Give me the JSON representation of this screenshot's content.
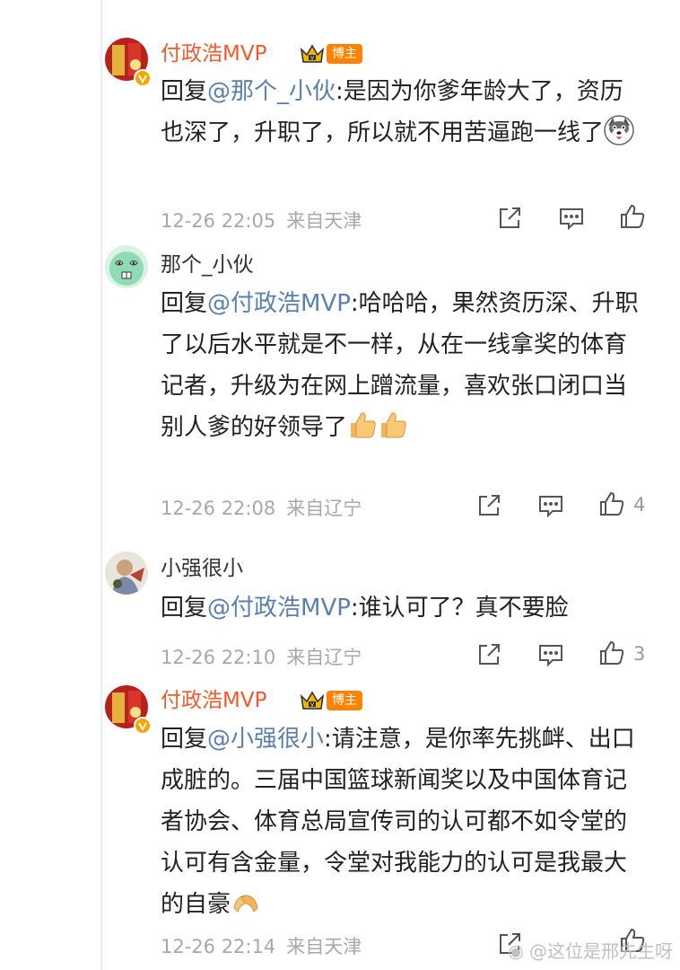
{
  "comments": [
    {
      "name": "付政浩MVP",
      "badge": "博主",
      "reply_prefix": "回复",
      "mention": "@那个_小伙",
      "body": ":是因为你爹年龄大了，资历也深了，升职了，所以就不用苦逼跑一线了",
      "time": "12-26 22:05",
      "source": "来自天津",
      "likes": ""
    },
    {
      "name": "那个_小伙",
      "reply_prefix": "回复",
      "mention": "@付政浩MVP",
      "body": ":哈哈哈，果然资历深、升职了以后水平就是不一样，从在一线拿奖的体育记者，升级为在网上蹭流量，喜欢张口闭口当别人爹的好领导了",
      "time": "12-26 22:08",
      "source": "来自辽宁",
      "likes": "4"
    },
    {
      "name": "小强很小",
      "reply_prefix": "回复",
      "mention": "@付政浩MVP",
      "body": ":谁认可了？真不要脸",
      "time": "12-26 22:10",
      "source": "来自辽宁",
      "likes": "3"
    },
    {
      "name": "付政浩MVP",
      "badge": "博主",
      "reply_prefix": "回复",
      "mention": "@小强很小",
      "body": ":请注意，是你率先挑衅、出口成脏的。三届中国篮球新闻奖以及中国体育记者协会、体育总局宣传司的认可都不如令堂的认可有含金量，令堂对我能力的认可是我最大的自豪",
      "time": "12-26 22:14",
      "source": "来自天津",
      "likes": ""
    }
  ],
  "watermark": "@这位是邢先生呀",
  "icons": {
    "share": "share-icon",
    "comment": "comment-icon",
    "like": "thumbs-up-icon",
    "crown": "crown-vip-icon",
    "verified": "verified-v-icon"
  },
  "colors": {
    "vip_name": "#f25a2a",
    "mention": "#5a7fb0",
    "meta": "#a8a8a8",
    "badge": "#ff8200"
  }
}
